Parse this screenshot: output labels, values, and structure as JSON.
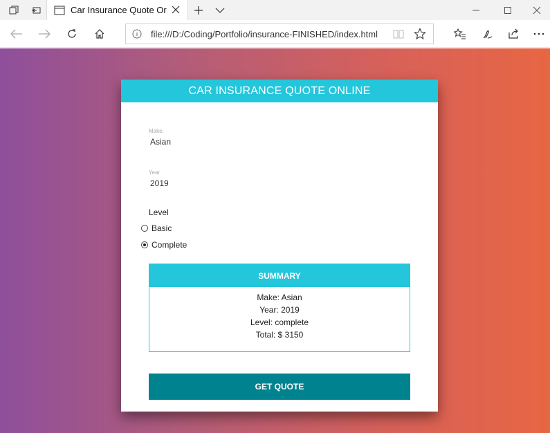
{
  "browser": {
    "tab_title": "Car Insurance Quote Or",
    "address": "file:///D:/Coding/Portfolio/insurance-FINISHED/index.html"
  },
  "page": {
    "title": "CAR INSURANCE QUOTE ONLINE",
    "make": {
      "label": "Make:",
      "value": "Asian"
    },
    "year": {
      "label": "Year",
      "value": "2019"
    },
    "level": {
      "label": "Level",
      "options": [
        {
          "label": "Basic",
          "checked": false
        },
        {
          "label": "Complete",
          "checked": true
        }
      ]
    },
    "summary": {
      "title": "SUMMARY",
      "lines": [
        "Make: Asian",
        "Year: 2019",
        "Level: complete",
        "Total: $ 3150"
      ]
    },
    "button_label": "GET QUOTE"
  },
  "colors": {
    "header": "#24c6dc",
    "button": "#00838f",
    "gradient_start": "#8e4f9b",
    "gradient_end": "#e76643"
  }
}
